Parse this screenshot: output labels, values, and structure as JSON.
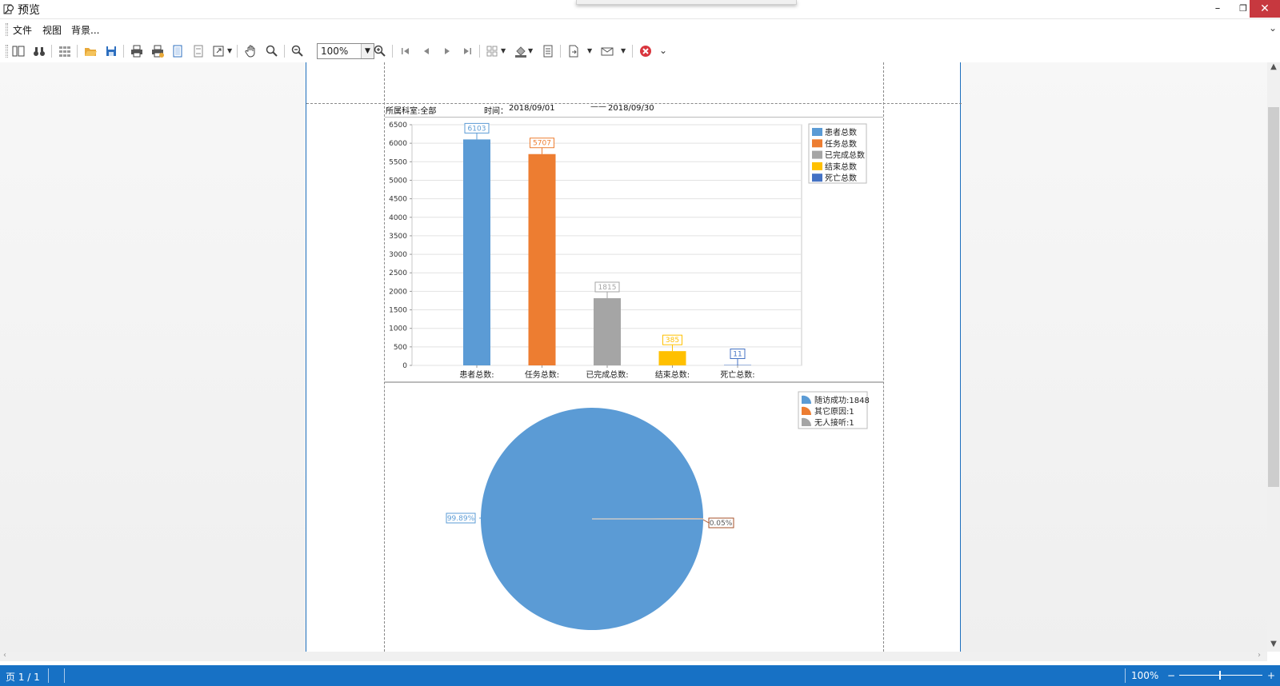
{
  "window": {
    "title": "预览"
  },
  "menu": {
    "items": [
      "文件",
      "视图",
      "背景..."
    ]
  },
  "toolbar": {
    "zoom_value": "100%"
  },
  "report": {
    "department_label": "所属科室:全部",
    "time_label": "时间：",
    "date_start": "2018/09/01",
    "date_end": "2018/09/30"
  },
  "chart_data": [
    {
      "type": "bar",
      "categories": [
        "患者总数:",
        "任务总数:",
        "已完成总数:",
        "结束总数:",
        "死亡总数:"
      ],
      "values": [
        6103,
        5707,
        1815,
        385,
        11
      ],
      "colors": [
        "#5b9bd5",
        "#ed7d31",
        "#a5a5a5",
        "#ffc000",
        "#4472c4"
      ],
      "legend": [
        "患者总数",
        "任务总数",
        "已完成总数",
        "结束总数",
        "死亡总数"
      ],
      "legend_position": "top-right",
      "ylim": [
        0,
        6500
      ],
      "yticks": [
        0,
        500,
        1000,
        1500,
        2000,
        2500,
        3000,
        3500,
        4000,
        4500,
        5000,
        5500,
        6000,
        6500
      ],
      "grid": true
    },
    {
      "type": "pie",
      "labels": [
        "随访成功",
        "其它原因",
        "无人接听"
      ],
      "values": [
        1848,
        1,
        1
      ],
      "legend": [
        "随访成功:1848",
        "其它原因:1",
        "无人接听:1"
      ],
      "colors": [
        "#5b9bd5",
        "#ed7d31",
        "#a5a5a5"
      ],
      "data_labels": [
        "99.89%",
        "0.05%"
      ],
      "legend_position": "top-right"
    }
  ],
  "status": {
    "page_label": "页 1 / 1",
    "zoom_label": "100%",
    "zoom_minus": "−",
    "zoom_plus": "+"
  }
}
